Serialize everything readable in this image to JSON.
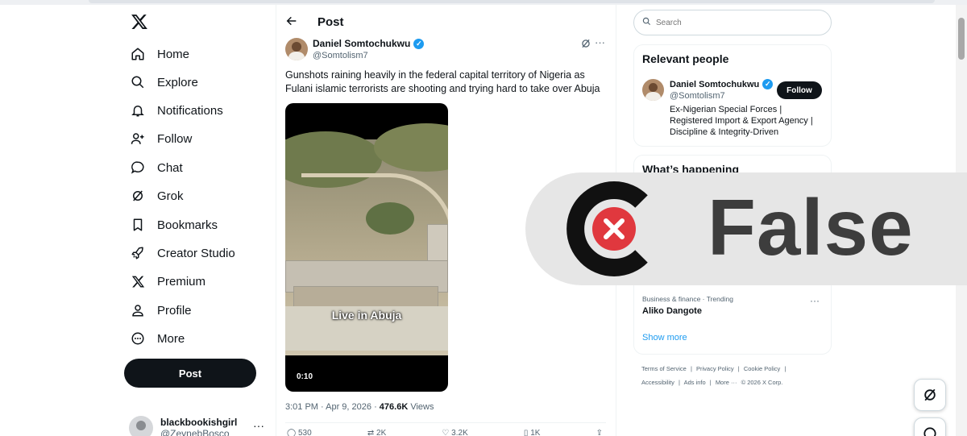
{
  "nav": {
    "items": [
      {
        "label": "Home",
        "icon": "home-icon"
      },
      {
        "label": "Explore",
        "icon": "search-icon"
      },
      {
        "label": "Notifications",
        "icon": "bell-icon"
      },
      {
        "label": "Follow",
        "icon": "add-user-icon"
      },
      {
        "label": "Chat",
        "icon": "chat-bubble-icon"
      },
      {
        "label": "Grok",
        "icon": "grok-icon"
      },
      {
        "label": "Bookmarks",
        "icon": "bookmark-icon"
      },
      {
        "label": "Creator Studio",
        "icon": "rocket-icon"
      },
      {
        "label": "Premium",
        "icon": "x-logo-icon"
      },
      {
        "label": "Profile",
        "icon": "person-icon"
      },
      {
        "label": "More",
        "icon": "more-circle-icon"
      }
    ],
    "post_button": "Post",
    "account": {
      "name": "blackbookishgirl",
      "handle": "@ZeynebBosco",
      "more": "···"
    }
  },
  "post": {
    "header_title": "Post",
    "author_name": "Daniel Somtochukwu",
    "author_handle": "@Somtolism7",
    "text": "Gunshots raining heavily in the federal capital territory of Nigeria as Fulani islamic terrorists are shooting and trying hard to take over Abuja",
    "video": {
      "caption": "Live in Abuja",
      "duration": "0:10"
    },
    "time": "3:01 PM · Apr 9, 2026 · ",
    "views_count": "476.6K",
    "views_label": " Views",
    "actions": {
      "replies": "530",
      "reposts": "2K",
      "likes": "3.2K",
      "bookmarks": "1K"
    },
    "more": "···"
  },
  "sidebar": {
    "search_placeholder": "Search",
    "relevant_title": "Relevant people",
    "person": {
      "name": "Daniel Somtochukwu",
      "handle": "@Somtolism7",
      "follow_label": "Follow",
      "bio": "Ex-Nigerian Special Forces | Registered Import & Export Agency | Discipline & Integrity-Driven"
    },
    "happening_title": "What’s happening",
    "trend": {
      "category": "Business & finance · Trending",
      "name": "Aliko Dangote",
      "more": "···"
    },
    "show_more": "Show more",
    "footer_row1": [
      "Terms of Service",
      "|",
      "Privacy Policy",
      "|",
      "Cookie Policy",
      "|"
    ],
    "footer_row2": [
      "Accessibility",
      "|",
      "Ads info",
      "|",
      "More ···",
      "© 2026 X Corp."
    ]
  },
  "stamp": {
    "label": "False",
    "mark_color": "#e0383e"
  },
  "colors": {
    "accent": "#1d9bf0",
    "text": "#0f1419",
    "muted": "#536471"
  }
}
